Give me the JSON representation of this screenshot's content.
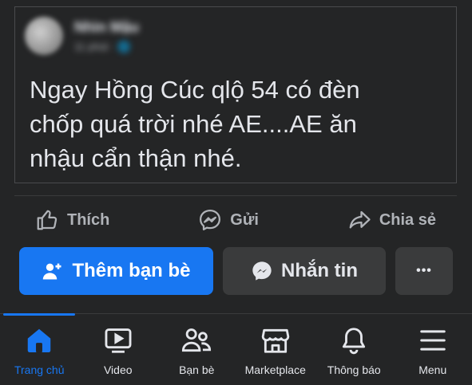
{
  "post": {
    "author_name": "Nhìn Mậu",
    "author_time": "11 phút · 🌐",
    "text": "Ngay Hồng Cúc qlộ 54 có đèn\nchốp quá trời nhé AE....AE ăn\nnhậu cẩn thận nhé."
  },
  "actions": {
    "like_label": "Thích",
    "send_label": "Gửi",
    "share_label": "Chia sẻ"
  },
  "buttons": {
    "add_friend_label": "Thêm bạn bè",
    "message_label": "Nhắn tin",
    "more_label": "•••"
  },
  "bottom_nav": {
    "items": [
      {
        "label": "Trang chủ",
        "icon": "home-icon",
        "active": true
      },
      {
        "label": "Video",
        "icon": "video-icon",
        "active": false
      },
      {
        "label": "Bạn bè",
        "icon": "friends-icon",
        "active": false
      },
      {
        "label": "Marketplace",
        "icon": "marketplace-icon",
        "active": false
      },
      {
        "label": "Thông báo",
        "icon": "bell-icon",
        "active": false
      },
      {
        "label": "Menu",
        "icon": "menu-icon",
        "active": false
      }
    ]
  },
  "colors": {
    "background": "#242526",
    "accent": "#1877f2",
    "text": "#e4e6eb",
    "muted": "#b0b3b8",
    "button_secondary": "#3a3b3c"
  }
}
